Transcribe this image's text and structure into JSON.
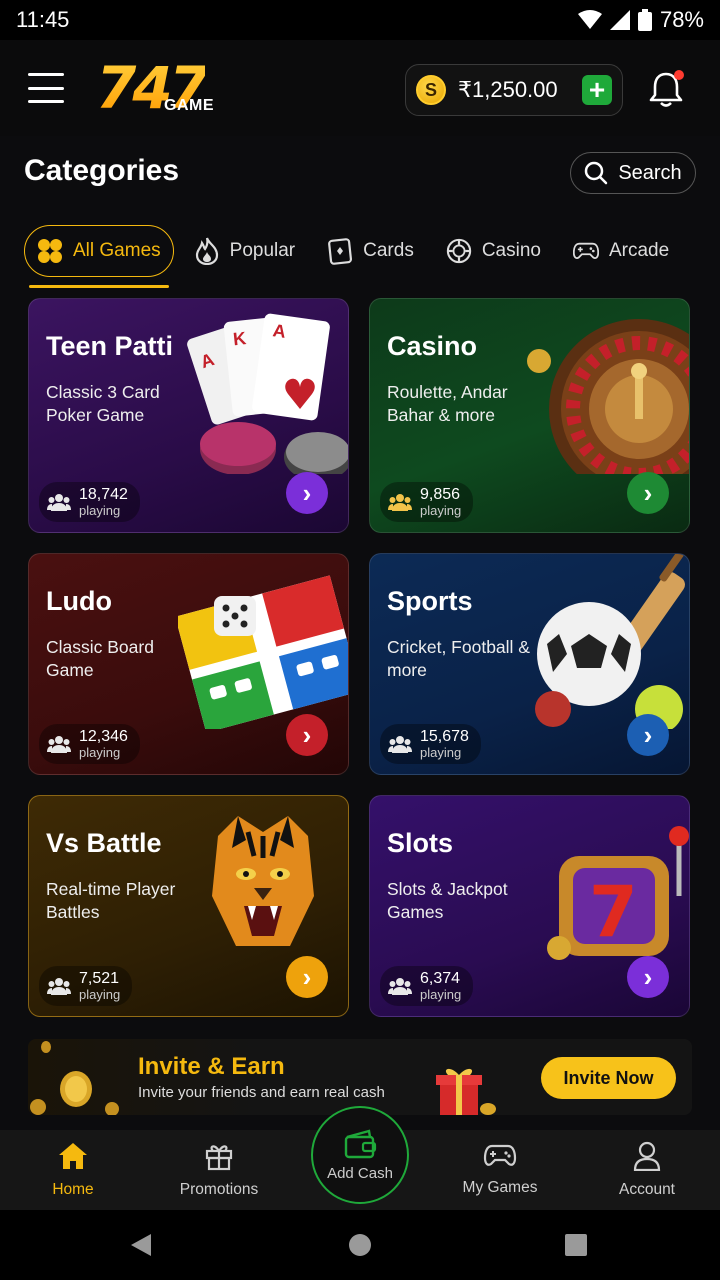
{
  "status": {
    "time": "11:45",
    "battery": "78%"
  },
  "header": {
    "logo_number": "747",
    "logo_word": "GAME",
    "balance": "₹1,250.00",
    "coin_symbol": "S",
    "add_symbol": "+"
  },
  "categories": {
    "title": "Categories",
    "search_label": "Search"
  },
  "tabs": [
    {
      "label": "All Games",
      "icon": "grid-icon"
    },
    {
      "label": "Popular",
      "icon": "flame-icon"
    },
    {
      "label": "Cards",
      "icon": "card-icon"
    },
    {
      "label": "Casino",
      "icon": "chip-icon"
    },
    {
      "label": "Arcade",
      "icon": "gamepad-icon"
    }
  ],
  "games": [
    {
      "title": "Teen Patti",
      "subtitle": "Classic 3 Card Poker Game",
      "players": "18,742",
      "players_label": "playing",
      "accent": "#7b2fd9"
    },
    {
      "title": "Casino",
      "subtitle": "Roulette, Andar Bahar & more",
      "players": "9,856",
      "players_label": "playing",
      "accent": "#1e8a34"
    },
    {
      "title": "Ludo",
      "subtitle": "Classic Board Game",
      "players": "12,346",
      "players_label": "playing",
      "accent": "#c4202a"
    },
    {
      "title": "Sports",
      "subtitle": "Cricket, Football & more",
      "players": "15,678",
      "players_label": "playing",
      "accent": "#1c5fb3"
    },
    {
      "title": "Vs Battle",
      "subtitle": "Real-time Player Battles",
      "players": "7,521",
      "players_label": "playing",
      "accent": "#eea20c"
    },
    {
      "title": "Slots",
      "subtitle": "Slots & Jackpot Games",
      "players": "6,374",
      "players_label": "playing",
      "accent": "#7b2fd9"
    }
  ],
  "invite": {
    "title": "Invite & Earn",
    "subtitle": "Invite your friends and earn real cash",
    "button": "Invite Now"
  },
  "bottom_nav": {
    "home": "Home",
    "promotions": "Promotions",
    "add_cash": "Add Cash",
    "my_games": "My Games",
    "account": "Account"
  },
  "colors": {
    "accent": "#f5b90f",
    "green": "#1fa93a"
  }
}
